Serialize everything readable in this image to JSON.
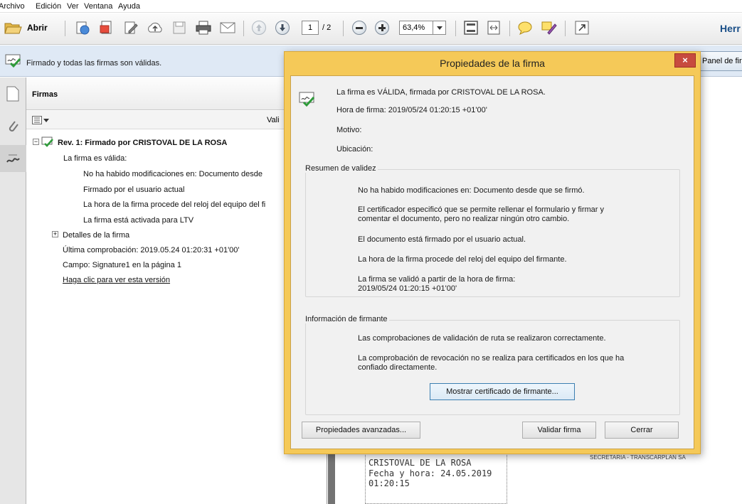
{
  "menu": [
    "Archivo",
    "Edición",
    "Ver",
    "Ventana",
    "Ayuda"
  ],
  "toolbar": {
    "open_label": "Abrir",
    "page_current": "1",
    "page_total": "/ 2",
    "zoom": "63,4%",
    "tools_label": "Herr"
  },
  "message_bar": {
    "text": "Firmado y todas las firmas son válidas.",
    "panel_button": "Panel de fir"
  },
  "signature_panel": {
    "title": "Firmas",
    "validate_label": "Vali",
    "revision": "Rev. 1: Firmado por CRISTOVAL DE LA ROSA",
    "items": [
      "La firma es válida:",
      "No ha habido modificaciones en: Documento desde",
      "Firmado por el usuario actual",
      "La hora de la firma procede del reloj del equipo del fi",
      "La firma está activada para LTV"
    ],
    "details": "Detalles de la firma",
    "last_check": "Última comprobación: 2019.05.24 01:20:31 +01'00'",
    "field": "Campo: Signature1 en la página 1",
    "link": "Haga clic para ver esta versión"
  },
  "document": {
    "signer_name": "CRISTOVAL DE LA ROSA",
    "date_line": "Fecha y hora: 24.05.2019",
    "time_line": "01:20:15",
    "right_text": "SECRETARIA - TRANSCARPLAN SA"
  },
  "dialog": {
    "title": "Propiedades de la firma",
    "close_glyph": "×",
    "status": "La firma es VÁLIDA, firmada por CRISTOVAL DE LA ROSA.",
    "sign_time": "Hora de firma:  2019/05/24 01:20:15 +01'00'",
    "reason": "Motivo:",
    "location": "Ubicación:",
    "validity_summary": {
      "label": "Resumen de validez",
      "lines": [
        "No ha habido modificaciones en: Documento desde que se firmó.",
        "El certificador especificó que se permite rellenar el formulario y firmar y",
        "comentar el documento, pero no realizar ningún otro cambio.",
        "El documento está firmado por el usuario actual.",
        "La hora de la firma procede del reloj del equipo del firmante.",
        "La firma se validó a partir de la hora de firma:",
        "2019/05/24 01:20:15 +01'00'"
      ]
    },
    "signer_info": {
      "label": "Información de firmante",
      "lines": [
        "Las comprobaciones de validación de ruta se realizaron correctamente.",
        "La comprobación de revocación no se realiza para certificados en los que ha",
        "confiado directamente."
      ],
      "show_cert_button": "Mostrar certificado de firmante..."
    },
    "advanced_button": "Propiedades avanzadas...",
    "validate_button": "Validar firma",
    "close_button": "Cerrar"
  }
}
